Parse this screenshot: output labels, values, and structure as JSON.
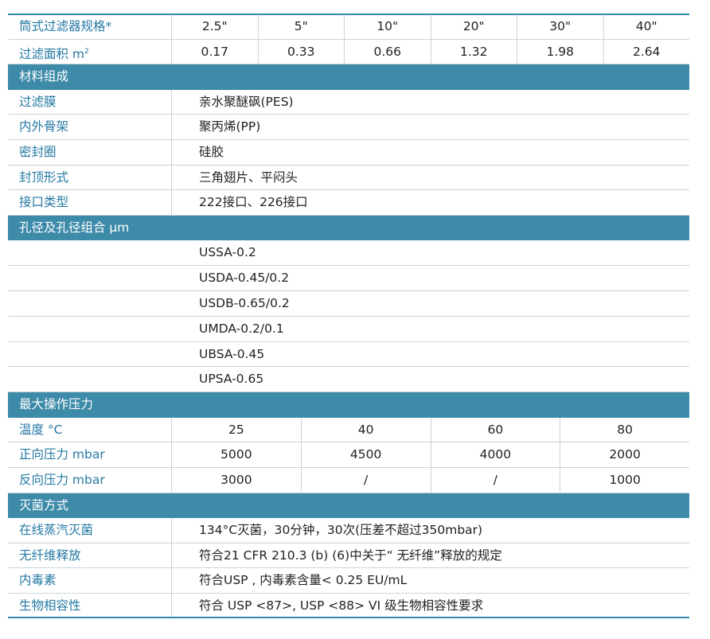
{
  "spec": {
    "size_label": "筒式过滤器规格*",
    "sizes": [
      "2.5\"",
      "5\"",
      "10\"",
      "20\"",
      "30\"",
      "40\""
    ],
    "area_label": "过滤面积 m",
    "area_sup": "2",
    "areas": [
      "0.17",
      "0.33",
      "0.66",
      "1.32",
      "1.98",
      "2.64"
    ]
  },
  "materials": {
    "header": "材料组成",
    "rows": [
      {
        "label": "过滤膜",
        "value": "亲水聚醚砜(PES)"
      },
      {
        "label": "内外骨架",
        "value": "聚丙烯(PP)"
      },
      {
        "label": "密封圈",
        "value": "硅胶"
      },
      {
        "label": "封顶形式",
        "value": "三角翅片、平闷头"
      },
      {
        "label": "接口类型",
        "value": "222接口、226接口"
      }
    ]
  },
  "pores": {
    "header": "孔径及孔径组合 μm",
    "items": [
      "USSA-0.2",
      "USDA-0.45/0.2",
      "USDB-0.65/0.2",
      "UMDA-0.2/0.1",
      "UBSA-0.45",
      "UPSA-0.65"
    ]
  },
  "pressure": {
    "header": "最大操作压力",
    "temp_label": "温度 °C",
    "temps": [
      "25",
      "40",
      "60",
      "80"
    ],
    "forward_label": "正向压力 mbar",
    "forward": [
      "5000",
      "4500",
      "4000",
      "2000"
    ],
    "reverse_label": "反向压力 mbar",
    "reverse": [
      "3000",
      "/",
      "/",
      "1000"
    ]
  },
  "sterilization": {
    "header": "灭菌方式",
    "rows": [
      {
        "label": "在线蒸汽灭菌",
        "value": "134°C灭菌，30分钟，30次(压差不超过350mbar)"
      },
      {
        "label": "无纤维释放",
        "value": "符合21 CFR 210.3 (b) (6)中关于“ 无纤维”释放的规定"
      },
      {
        "label": "内毒素",
        "value": "符合USP , 内毒素含量< 0.25 EU/mL"
      },
      {
        "label": "生物相容性",
        "value": "符合 USP <87>, USP <88> VI 级生物相容性要求"
      }
    ]
  },
  "colors": {
    "accent": "#3d8aa9",
    "label_text": "#2579a3",
    "rule": "#c9d3d8"
  }
}
